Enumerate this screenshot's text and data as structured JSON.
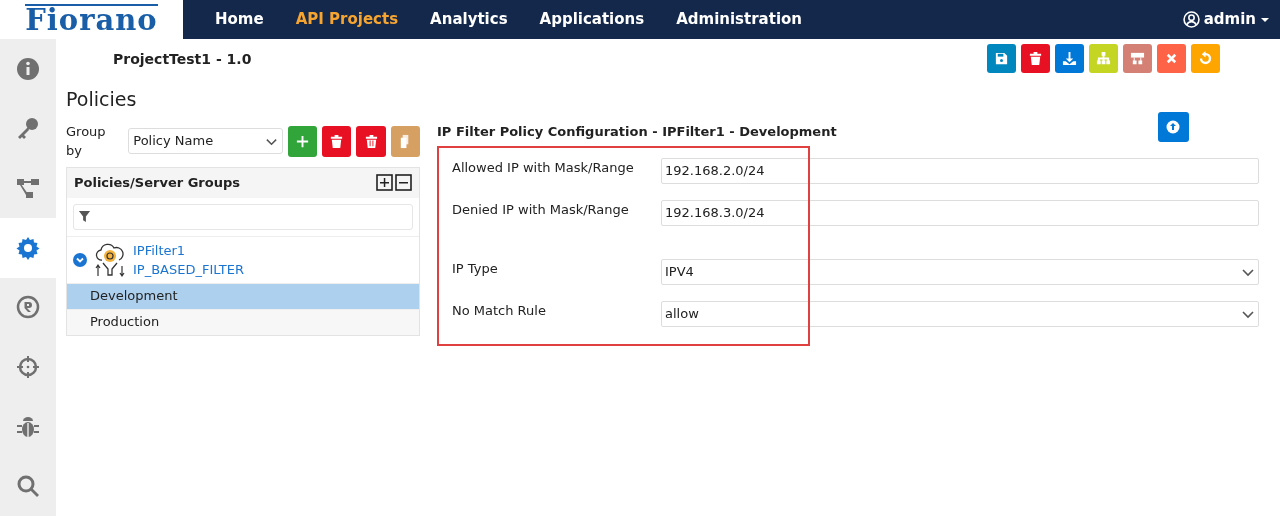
{
  "brand": {
    "logo": "Fiorano"
  },
  "nav": {
    "items": [
      {
        "label": "Home",
        "selected": false
      },
      {
        "label": "API Projects",
        "selected": true
      },
      {
        "label": "Analytics",
        "selected": false
      },
      {
        "label": "Applications",
        "selected": false
      },
      {
        "label": "Administration",
        "selected": false
      }
    ],
    "user": "admin"
  },
  "sidebar": {
    "items": [
      {
        "selected": false
      },
      {
        "selected": false
      },
      {
        "selected": false
      },
      {
        "selected": true
      },
      {
        "selected": false
      },
      {
        "selected": false
      },
      {
        "selected": false
      },
      {
        "selected": false
      }
    ]
  },
  "project_title": "ProjectTest1 - 1.0",
  "toolbar": [
    {
      "color": "#0087be"
    },
    {
      "color": "#e81123"
    },
    {
      "color": "#0078d7"
    },
    {
      "color": "#c5d524"
    },
    {
      "color": "#d48074"
    },
    {
      "color": "#ff6347"
    },
    {
      "color": "#ffa500"
    }
  ],
  "policies": {
    "heading": "Policies",
    "group_by_label": "Group by",
    "group_by_value": "Policy Name",
    "buttons": [
      {
        "color": "#31a43a"
      },
      {
        "color": "#e81123"
      },
      {
        "color": "#e81123"
      },
      {
        "color": "#d6a063"
      }
    ],
    "panel_title": "Policies/Server Groups",
    "tree": [
      {
        "name": "IPFilter1",
        "type": "IP_BASED_FILTER",
        "expanded": true,
        "children": [
          {
            "label": "Development",
            "selected": true
          },
          {
            "label": "Production",
            "selected": false
          }
        ]
      }
    ]
  },
  "config": {
    "title": "IP Filter Policy Configuration - IPFilter1 - Development",
    "fields": [
      {
        "kind": "text",
        "label": "Allowed IP with Mask/Range",
        "value": "192.168.2.0/24"
      },
      {
        "kind": "text",
        "label": "Denied IP with Mask/Range",
        "value": "192.168.3.0/24"
      },
      {
        "kind": "select",
        "label": "IP Type",
        "value": "IPV4"
      },
      {
        "kind": "select",
        "label": "No Match Rule",
        "value": "allow"
      }
    ]
  }
}
